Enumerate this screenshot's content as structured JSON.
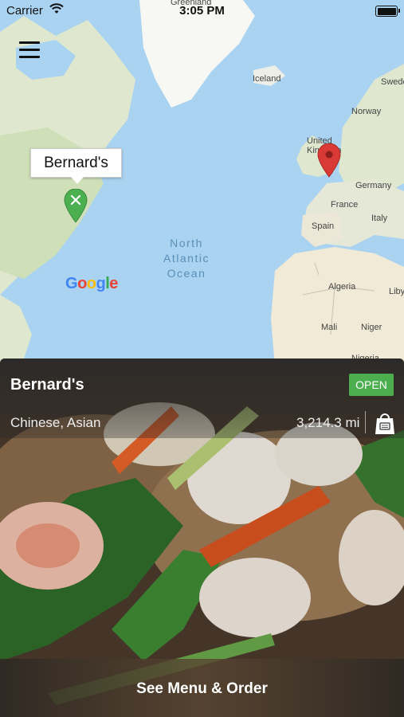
{
  "status_bar": {
    "carrier": "Carrier",
    "time": "3:05 PM"
  },
  "map": {
    "labels": {
      "greenland": "Greenland",
      "iceland": "Iceland",
      "united_kingdom": "United Kingdom",
      "sweden": "Swede",
      "norway": "Norway",
      "germany": "Germany",
      "france": "France",
      "italy": "Italy",
      "spain": "Spain",
      "algeria": "Algeria",
      "libya": "Liby",
      "mali": "Mali",
      "niger": "Niger",
      "nigeria": "Nigeria",
      "ocean_line1": "North",
      "ocean_line2": "Atlantic",
      "ocean_line3": "Ocean"
    },
    "callout": "Bernard's",
    "attribution": "Google"
  },
  "card": {
    "name": "Bernard's",
    "status": "OPEN",
    "cuisine": "Chinese, Asian",
    "distance": "3,214.3 mi",
    "cta": "See Menu & Order"
  },
  "colors": {
    "open": "#4cae4f",
    "pin_green": "#4caf50",
    "pin_red": "#d93a35",
    "water": "#a9d3f0",
    "land": "#e9e5dc"
  }
}
